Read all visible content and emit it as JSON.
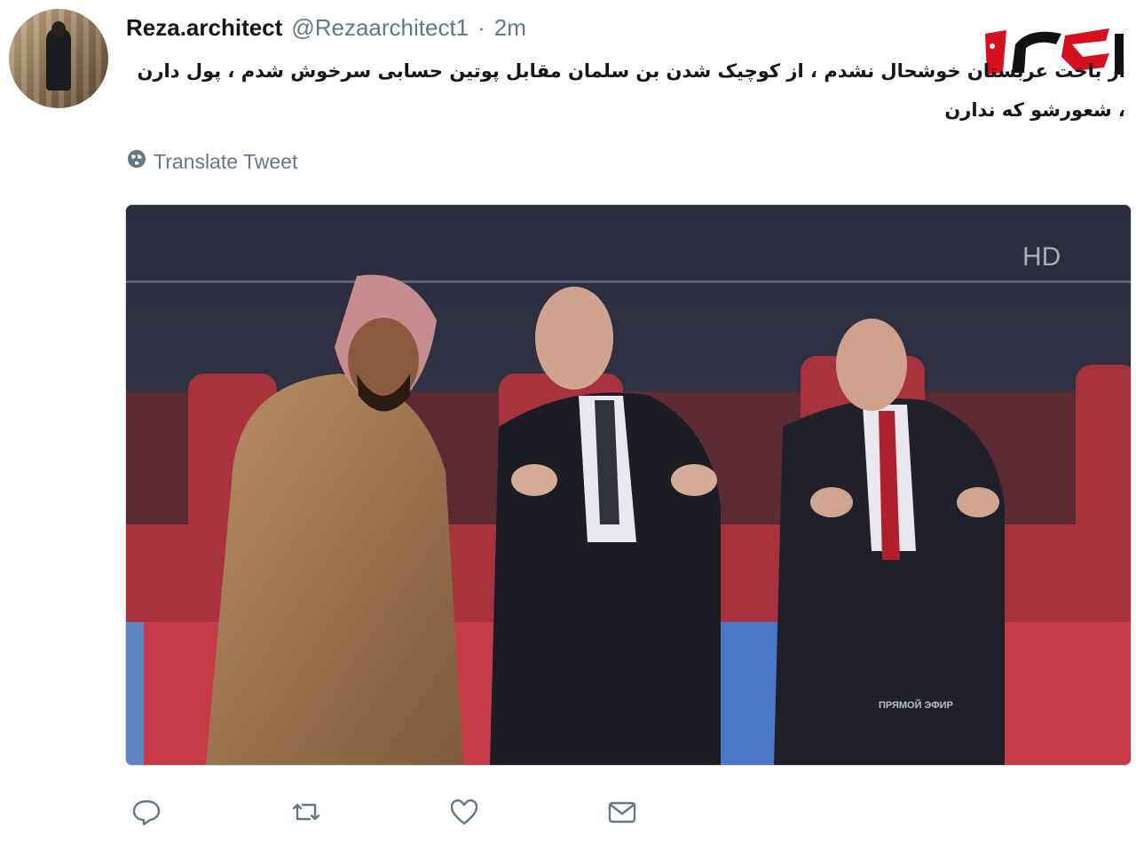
{
  "tweet": {
    "display_name": "Reza.architect",
    "handle": "@Rezaarchitect1",
    "separator": "·",
    "timestamp": "2m",
    "text": "از باخت عربستان خوشحال نشدم ، از کوچیک شدن بن سلمان مقابل پوتین حسابی سرخوش شدم ، پول دارن ، شعورشو که ندارن",
    "translate_label": "Translate Tweet"
  },
  "media": {
    "broadcaster_mark": "HD",
    "live_caption": "ПРЯМОЙ ЭФИР"
  },
  "actions": [
    "reply-icon",
    "retweet-icon",
    "like-icon",
    "direct-message-icon"
  ],
  "logo": {
    "colors": [
      "#d6101e",
      "#111111"
    ]
  }
}
